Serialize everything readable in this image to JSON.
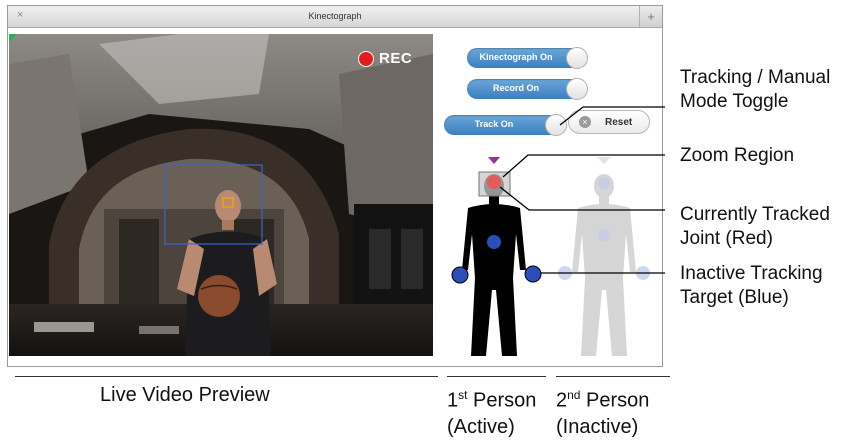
{
  "window": {
    "title": "Kinectograph",
    "close_glyph": "×",
    "add_glyph": "+"
  },
  "video": {
    "rec_label": "REC"
  },
  "controls": {
    "kinectograph_toggle": "Kinectograph On",
    "record_toggle": "Record On",
    "track_toggle": "Track On",
    "reset_label": "Reset",
    "reset_icon": "close-circle-icon"
  },
  "callouts": {
    "mode_toggle_line1": "Tracking / Manual",
    "mode_toggle_line2": "Mode Toggle",
    "zoom_region": "Zoom Region",
    "tracked_joint_line1": "Currently Tracked",
    "tracked_joint_line2": "Joint (Red)",
    "inactive_target_line1": "Inactive Tracking",
    "inactive_target_line2": "Target  (Blue)"
  },
  "bottom_labels": {
    "live_preview": "Live Video Preview",
    "person1_num": "1",
    "person1_sup": "st",
    "person1_word": " Person",
    "person1_state": "(Active)",
    "person2_num": "2",
    "person2_sup": "nd",
    "person2_word": " Person",
    "person2_state": "(Inactive)"
  },
  "colors": {
    "active_joint": "#e25c5c",
    "inactive_joint": "#2b4fb8",
    "toggle_blue": "#3c7fc0",
    "rec_red": "#e21d1d",
    "marker_purple": "#a8279c"
  }
}
